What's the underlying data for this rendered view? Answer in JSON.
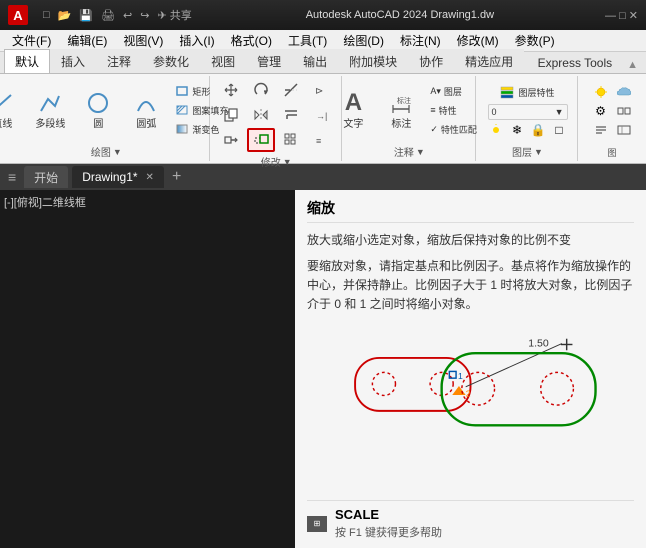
{
  "titlebar": {
    "app_icon": "A",
    "title": "Autodesk AutoCAD 2024    Drawing1.dw",
    "share_label": "共享",
    "toolbar_icons": [
      "□",
      "□",
      "□",
      "◀",
      "▶",
      "□"
    ]
  },
  "menubar": {
    "items": [
      "文件(F)",
      "编辑(E)",
      "视图(V)",
      "插入(I)",
      "格式(O)",
      "工具(T)",
      "绘图(D)",
      "标注(N)",
      "修改(M)",
      "参数(P)"
    ]
  },
  "ribbon_tabs": {
    "tabs": [
      "默认",
      "插入",
      "注释",
      "参数化",
      "视图",
      "管理",
      "输出",
      "附加模块",
      "协作",
      "精选应用",
      "Express Tools"
    ],
    "active": "默认",
    "collapse_icon": "□"
  },
  "ribbon": {
    "draw_group": {
      "label": "绘图",
      "row1": [
        "直线",
        "多段线",
        "圆",
        "圆弧"
      ],
      "icons": [
        "╱",
        "⌒",
        "○",
        "◜"
      ]
    },
    "modify_group": {
      "label": "修改",
      "buttons": [
        {
          "icon": "↗",
          "label": "移动"
        },
        {
          "icon": "↻",
          "label": "旋转"
        },
        {
          "icon": "✂",
          "label": "修剪"
        },
        {
          "icon": "⊡",
          "label": "复制"
        },
        {
          "icon": "⊟",
          "label": "镜像"
        },
        {
          "icon": "↔",
          "label": "延伸"
        },
        {
          "icon": "□",
          "label": "拉伸"
        },
        {
          "icon": "⊞",
          "label": "缩放"
        },
        {
          "icon": "⊞",
          "label": "阵列"
        }
      ],
      "scale_highlighted": true
    },
    "annotation_group": {
      "label": "注释",
      "buttons": [
        "文字",
        "标注"
      ]
    },
    "layers_group": {
      "label": "图层"
    }
  },
  "doc_tabs": {
    "items": [
      {
        "label": "开始",
        "closable": false
      },
      {
        "label": "Drawing1*",
        "closable": true,
        "active": true
      }
    ],
    "add_label": "+"
  },
  "canvas": {
    "viewport_label": "[-][俯视]二维线框"
  },
  "help_panel": {
    "title": "缩放",
    "description": "放大或缩小选定对象，缩放后保持对象的比例不变",
    "detail": "要缩放对象，请指定基点和比例因子。基点将作为缩放操作的中心，并保持静止。比例因子大于 1 时将放大对象，比例因子介于 0 和 1 之间时将缩小对象。",
    "scale_value": "1.50",
    "diagram": {
      "original": "dotted rectangle with circles",
      "result": "scaled shape"
    },
    "bottom_icon": "■",
    "command_name": "SCALE",
    "hint": "按 F1 键获得更多帮助"
  },
  "icons": {
    "move": "↗",
    "rotate": "↻",
    "trim": "✂",
    "copy": "⊡",
    "mirror": "⊟",
    "extend": "↔",
    "stretch": "□",
    "scale": "⊞",
    "array": "⊞",
    "line": "╱",
    "polyline": "⌒",
    "circle": "○",
    "arc": "◜",
    "text": "A",
    "dimension": "↔|"
  }
}
